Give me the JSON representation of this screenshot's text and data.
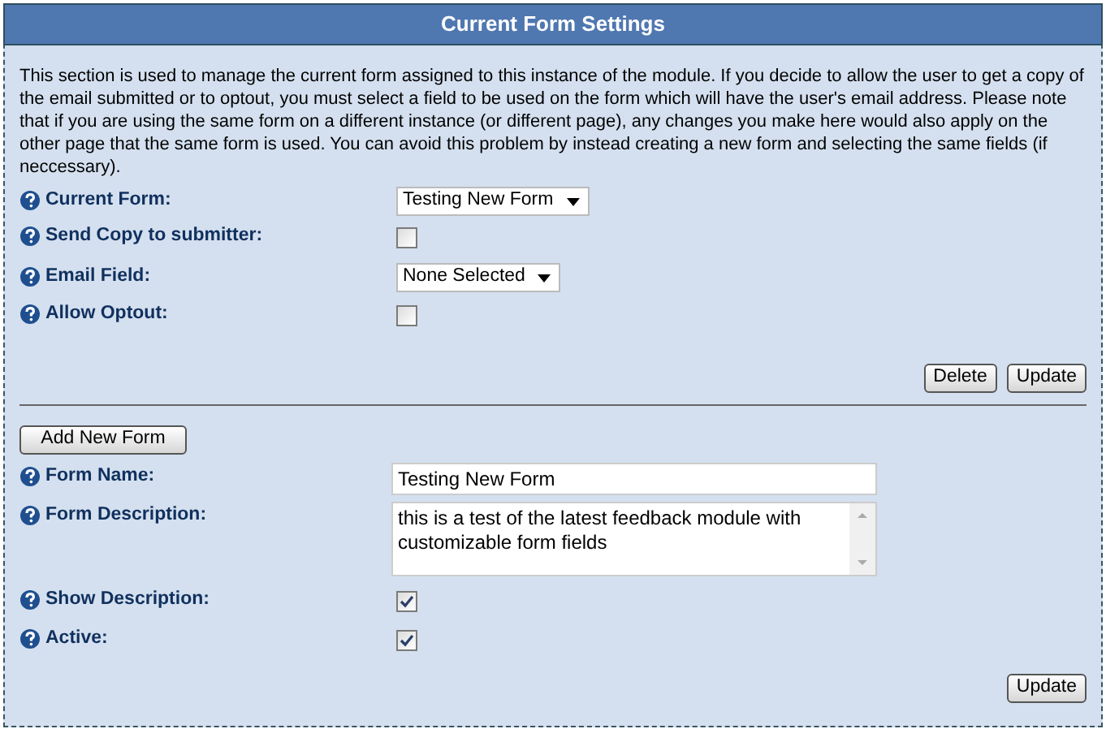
{
  "header": {
    "title": "Current Form Settings"
  },
  "description": "This section is used to manage the current form assigned to this instance of the module. If you decide to allow the user to get a copy of the email submitted or to optout, you must select a field to be used on the form which will have the user's email address. Please note that if you are using the same form on a different instance (or different page), any changes you make here would also apply on the other page that the same form is used. You can avoid this problem by instead creating a new form and selecting the same fields (if neccessary).",
  "settings": [
    {
      "label": "Current Form:",
      "kind": "select",
      "value": "Testing New Form"
    },
    {
      "label": "Send Copy to submitter:",
      "kind": "checkbox",
      "checked": false
    },
    {
      "label": "Email Field:",
      "kind": "select",
      "value": "None Selected"
    },
    {
      "label": "Allow Optout:",
      "kind": "checkbox",
      "checked": false
    }
  ],
  "settings_buttons": [
    "Delete",
    "Update"
  ],
  "add_button": "Add New Form",
  "form_fields": [
    {
      "label": "Form Name:",
      "kind": "text",
      "value": "Testing New Form"
    },
    {
      "label": "Form Description:",
      "kind": "textarea",
      "value": "this is a test of the latest feedback module with customizable form fields"
    },
    {
      "label": "Show Description:",
      "kind": "checkbox",
      "checked": true
    },
    {
      "label": "Active:",
      "kind": "checkbox",
      "checked": true
    }
  ],
  "form_buttons": [
    "Update"
  ]
}
